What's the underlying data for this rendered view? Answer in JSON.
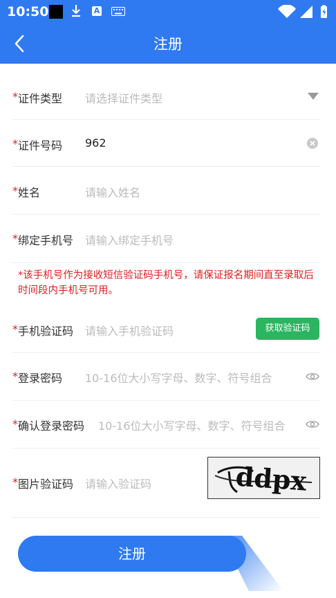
{
  "status_bar": {
    "time": "10:50",
    "icons": [
      "notification-square-icon",
      "download-icon",
      "a-icon",
      "keyboard-icon",
      "wifi-icon",
      "signal-icon",
      "battery-icon"
    ],
    "a_glyph": "A"
  },
  "header": {
    "title": "注册",
    "back_icon": "chevron-left-icon",
    "color": "#2f7af0"
  },
  "form": {
    "required_mark": "*",
    "id_type": {
      "label": "证件类型",
      "placeholder": "请选择证件类型"
    },
    "id_number": {
      "label": "证件号码",
      "value": "962"
    },
    "name": {
      "label": "姓名",
      "placeholder": "请输入姓名"
    },
    "phone": {
      "label": "绑定手机号",
      "placeholder": "请输入绑定手机号"
    },
    "notice": "*该手机号作为接收短信验证码手机号，请保证报名期间直至录取后时间段内手机号可用。",
    "sms_code": {
      "label": "手机验证码",
      "placeholder": "请输入手机验证码",
      "button": "获取验证码"
    },
    "password": {
      "label": "登录密码",
      "placeholder": "10-16位大小写字母、数字、符号组合"
    },
    "confirm_password": {
      "label": "确认登录密码",
      "placeholder": "10-16位大小写字母、数字、符号组合"
    },
    "captcha": {
      "label": "图片验证码",
      "placeholder": "请输入验证码",
      "image_text": "ddpx"
    }
  },
  "submit": {
    "label": "注册"
  },
  "colors": {
    "primary": "#2f7af0",
    "required": "#e02020",
    "sms_button": "#2bb560"
  }
}
